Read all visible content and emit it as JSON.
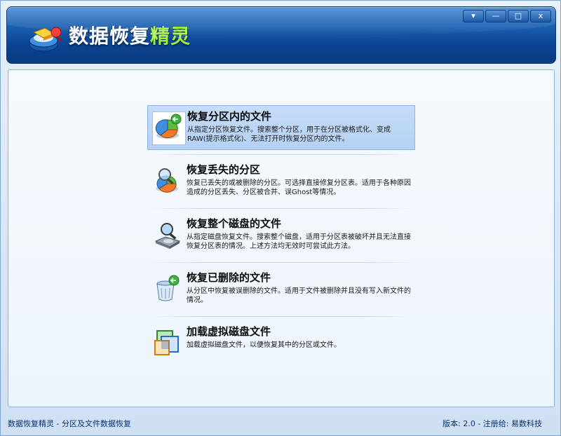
{
  "app": {
    "title_main": "数据恢复",
    "title_accent": "精灵",
    "logo": "data-recovery-logo-icon"
  },
  "window_controls": {
    "menu": "▾",
    "minimize": "—",
    "maximize": "□",
    "close": "x"
  },
  "options": [
    {
      "title": "恢复分区内的文件",
      "description": "从指定分区恢复文件。搜索整个分区，用于在分区被格式化、变成RAW(提示格式化)、无法打开时恢复分区内的文件。",
      "icon": "partition-pie-icon",
      "selected": true
    },
    {
      "title": "恢复丢失的分区",
      "description": "恢复已丢失的或被删除的分区。可选择直接修复分区表。适用于各种原因造成的分区丢失、分区被合并、误Ghost等情况。",
      "icon": "search-partition-icon",
      "selected": false
    },
    {
      "title": "恢复整个磁盘的文件",
      "description": "从指定磁盘恢复文件。搜索整个磁盘，适用于分区表被破坏并且无法直接恢复分区表的情况。上述方法均无效时可尝试此方法。",
      "icon": "disk-search-icon",
      "selected": false
    },
    {
      "title": "恢复已删除的文件",
      "description": "从分区中恢复被误删除的文件。适用于文件被删除并且没有写入新文件的情况。",
      "icon": "recycle-bin-icon",
      "selected": false
    },
    {
      "title": "加载虚拟磁盘文件",
      "description": "加载虚拟磁盘文件，以便恢复其中的分区或文件。",
      "icon": "virtual-disk-icon",
      "selected": false
    }
  ],
  "status": {
    "left": "数据恢复精灵 - 分区及文件数据恢复",
    "right": "版本: 2.0 - 注册给: 易数科技"
  },
  "colors": {
    "banner": "#1a5fb0",
    "accent": "#9cf03a",
    "selected_bg": "#b4d0f3"
  }
}
